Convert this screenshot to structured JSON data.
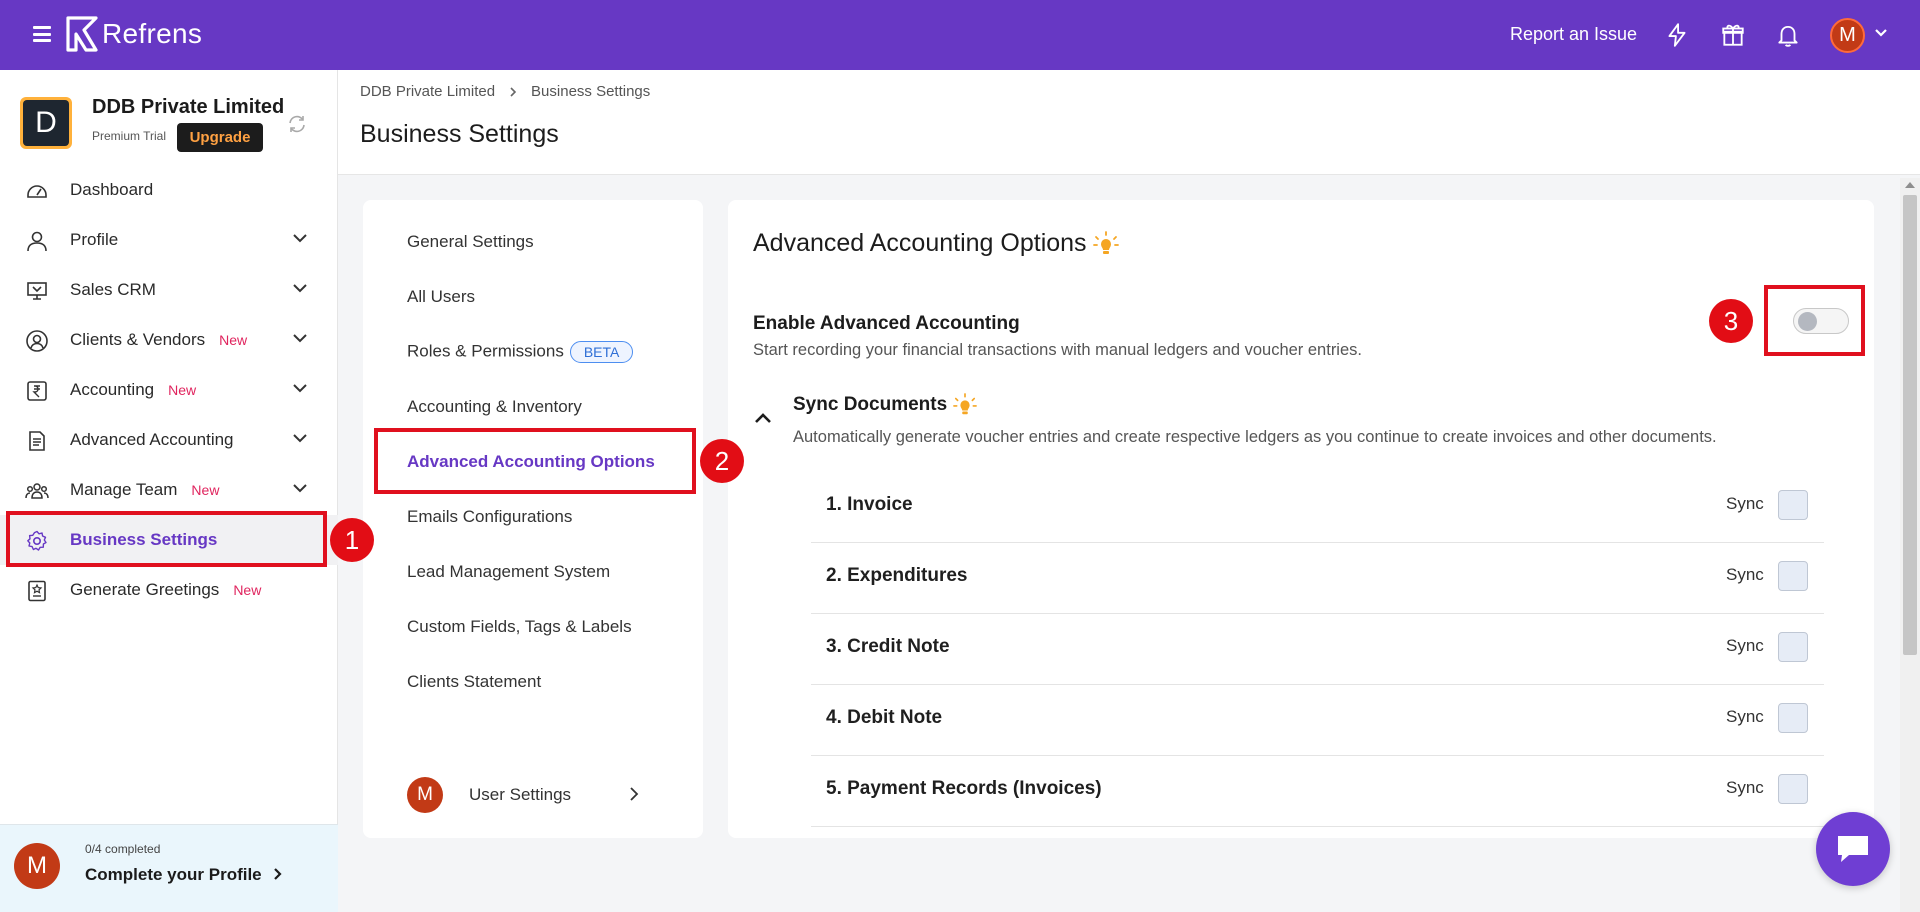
{
  "app": {
    "brand": "Refrens",
    "report_issue": "Report an Issue",
    "user_initial": "M"
  },
  "sidebar": {
    "org_initial": "D",
    "org_name": "DDB Private Limited",
    "plan": "Premium Trial",
    "upgrade": "Upgrade",
    "items": [
      {
        "label": "Dashboard",
        "new": ""
      },
      {
        "label": "Profile",
        "new": ""
      },
      {
        "label": "Sales CRM",
        "new": ""
      },
      {
        "label": "Clients & Vendors",
        "new": "New"
      },
      {
        "label": "Accounting",
        "new": "New"
      },
      {
        "label": "Advanced Accounting",
        "new": ""
      },
      {
        "label": "Manage Team",
        "new": "New"
      },
      {
        "label": "Business Settings",
        "new": ""
      },
      {
        "label": "Generate Greetings",
        "new": "New"
      }
    ],
    "profile_footer": {
      "initial": "M",
      "progress": "0/4 completed",
      "title": "Complete your Profile"
    }
  },
  "header": {
    "breadcrumb": [
      "DDB Private Limited",
      "Business Settings"
    ],
    "title": "Business Settings"
  },
  "settings_menu": {
    "items": [
      "General Settings",
      "All Users",
      "Roles & Permissions",
      "Accounting & Inventory",
      "Advanced Accounting Options",
      "Emails Configurations",
      "Lead Management System",
      "Custom Fields, Tags & Labels",
      "Clients Statement"
    ],
    "beta_badge": "BETA",
    "active": "Advanced Accounting Options",
    "user_initial": "M",
    "user_settings": "User Settings"
  },
  "content": {
    "title": "Advanced Accounting Options",
    "enable_title": "Enable Advanced Accounting",
    "enable_desc": "Start recording your financial transactions with manual ledgers and voucher entries.",
    "enable_on": false,
    "sync_title": "Sync Documents",
    "sync_desc": "Automatically generate voucher entries and create respective ledgers as you continue to create invoices and other documents.",
    "sync_label": "Sync",
    "documents": [
      "1. Invoice",
      "2. Expenditures",
      "3. Credit Note",
      "4. Debit Note",
      "5. Payment Records (Invoices)"
    ]
  },
  "annotations": [
    "1",
    "2",
    "3"
  ],
  "colors": {
    "brand": "#6738c4",
    "annotation": "#e20d15",
    "new_badge": "#e0245e",
    "bulb": "#f5a623"
  }
}
